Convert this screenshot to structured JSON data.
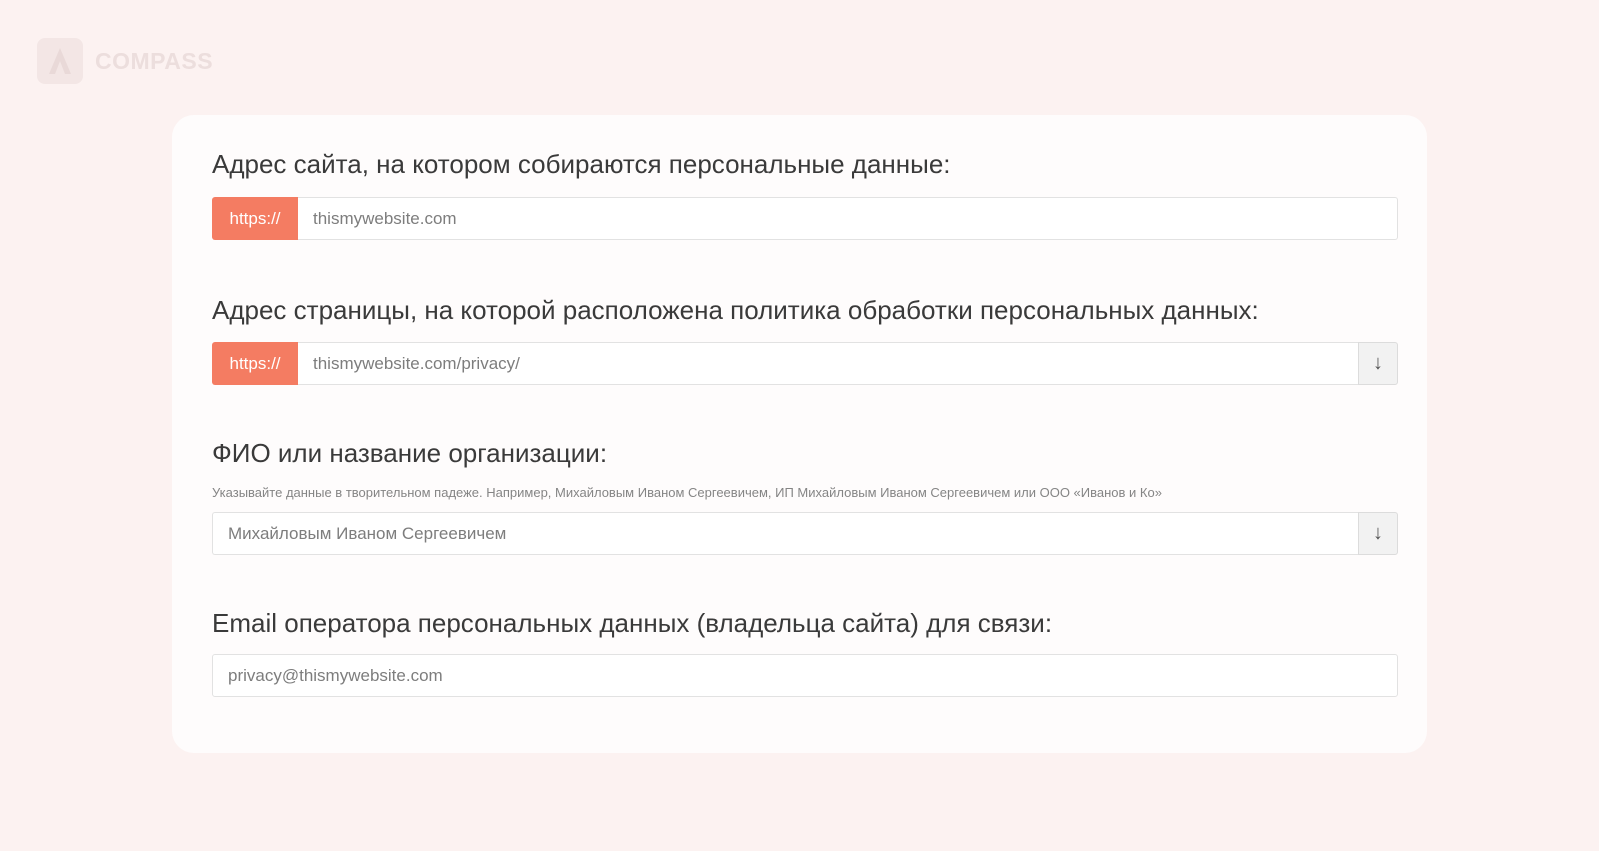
{
  "brand": {
    "name": "COMPASS"
  },
  "form": {
    "site_address": {
      "label": "Адрес сайта, на котором собираются персональные данные:",
      "prefix": "https://",
      "value": "thismywebsite.com"
    },
    "policy_address": {
      "label": "Адрес страницы, на которой расположена политика обработки персональных данных:",
      "prefix": "https://",
      "value": "thismywebsite.com/privacy/",
      "button_icon": "arrow-down-icon"
    },
    "operator_name": {
      "label": "ФИО или название организации:",
      "hint": "Указывайте данные в творительном падеже. Например, Михайловым Иваном Сергеевичем, ИП Михайловым Иваном Сергеевичем или ООО «Иванов и Ко»",
      "value": "Михайловым Иваном Сергеевичем",
      "button_icon": "arrow-down-icon"
    },
    "operator_email": {
      "label": "Email оператора персональных данных (владельца сайта) для связи:",
      "value": "privacy@thismywebsite.com"
    }
  },
  "colors": {
    "accent": "#f47c62",
    "background": "#fcf2f1",
    "card": "#fefcfc"
  }
}
